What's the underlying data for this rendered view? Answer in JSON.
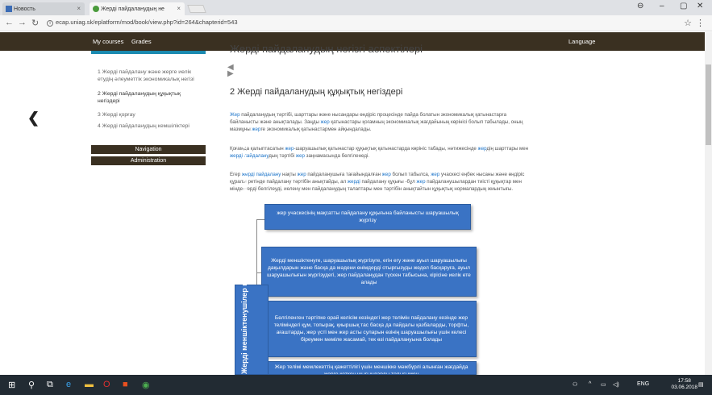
{
  "browser": {
    "tabs": [
      {
        "label": "Новость"
      },
      {
        "label": "Жерді пайдаланудың не"
      }
    ],
    "url": "ecap.uniag.sk/eplatform/mod/book/view.php?id=264&chapterid=543"
  },
  "navbar": {
    "my_courses": "My courses",
    "grades": "Grades",
    "language": "Language"
  },
  "page": {
    "title": "Жерді пайдаланудың негізгі аспектілері",
    "heading": "2 Жерді пайдаланудың құқықтық негіздері"
  },
  "toc": {
    "items": [
      "1 Жерді пайдалану және жерге иелік етудің әлеуметтік экономикалық негізі",
      "2 Жерді пайдаланудың құқықтық негіздері",
      "3 Жерді қорғау",
      "4 Жерді пайдаланудың кемшіліктері"
    ],
    "navigation": "Navigation",
    "administration": "Administration"
  },
  "paragraphs": {
    "p1": {
      "link1": "Жер",
      "t1": " пайдаланудың тәртібі, шарттары және нысандары өндіріс процесінде пайда болатын экономикалық қатынастарға",
      "t2": "байланысты және анықталады. Заңды ",
      "link2": "жер",
      "t3": " қатынастары қоғамның экономикалық жағдайының көрінісі болып табылады, оның",
      "t4": "мазмұны ",
      "link3": "жер",
      "t5": "ге экономикалық қатынастармен айқындалады."
    },
    "p2": {
      "t1": "Қоғамда қалыптасатын ",
      "link1": "жер",
      "t2": "-шаруашылық қатынастар құқықтық қатынастарда көрініс табады, нәтижесінде ",
      "link2": "жер",
      "t3": "дің шарттары мен",
      "link3": "жерді пайдалану",
      "t4": "дың тәртібі ",
      "link4": "жер",
      "t5": " заңнамасында белгіленеді."
    },
    "p3": {
      "t1": "Егер ",
      "link1": "жерді пайдалану",
      "t2": " нақты ",
      "link2": "жер",
      "t3": " пайдаланушыға тағайындалған ",
      "link3": "жер",
      "t4": " болып табылса, ",
      "link4": "жер",
      "t5": " учаскесі еңбек нысаны және өндіріс",
      "t6": "құралы ретінде пайдалану тәртібін анықтайды, ал ",
      "link5": "жерді",
      "t7": " пайдалану құқығы -бұл ",
      "link6": "жер",
      "t8": " пайдаланушылардан тиісті құқықтар мен",
      "t9": "міндеттерді белгілеуді, иеленү мен пайдаланудың талаптары мен тәртібін анықтайтын құқықтық нормалардың жиынтығы."
    }
  },
  "diagram": {
    "box1": "жер учаскесінің мақсатты пайдалану құқығына байланысты шаруашылық жүргізу",
    "box2": "Жерді меншіктенуге, шаруашылық жүргізуге, егін егу және ауыл шаруашылығы дақылдарын және басқа да мәдени өнімдерді отырғызуды жедел басқаруға, ауыл шаруашылығын жүргізудегі, жер пайдаланудан түскен табысына, кірісіне иелік ете алады",
    "box3": "Белгіленген тәртіпке орай келісім кезіндегі жер телімін пайдалану кезінде жер теліміндегі құм, топырақ, қиыршық тас басқа да пайдалы қазбаларды, торфты, ағаштарды, жер үсті мен жер асты суларын өзінің шаруашылығы үшін келесі біреумен мәміле жасамай, тек өзі пайдалануына болады",
    "box4": "Жер телімі мемлекеттің қажеттілігі үшін меншікке мәжбүрлі алынған жағдайда жерге кеткен шығындарды толығымен",
    "vertical": "Жерді меншіктенушілер мен жер пайдаланушылардың құқықтары"
  },
  "taskbar": {
    "lang": "ENG",
    "time": "17:58",
    "date": "03.06.2018"
  }
}
